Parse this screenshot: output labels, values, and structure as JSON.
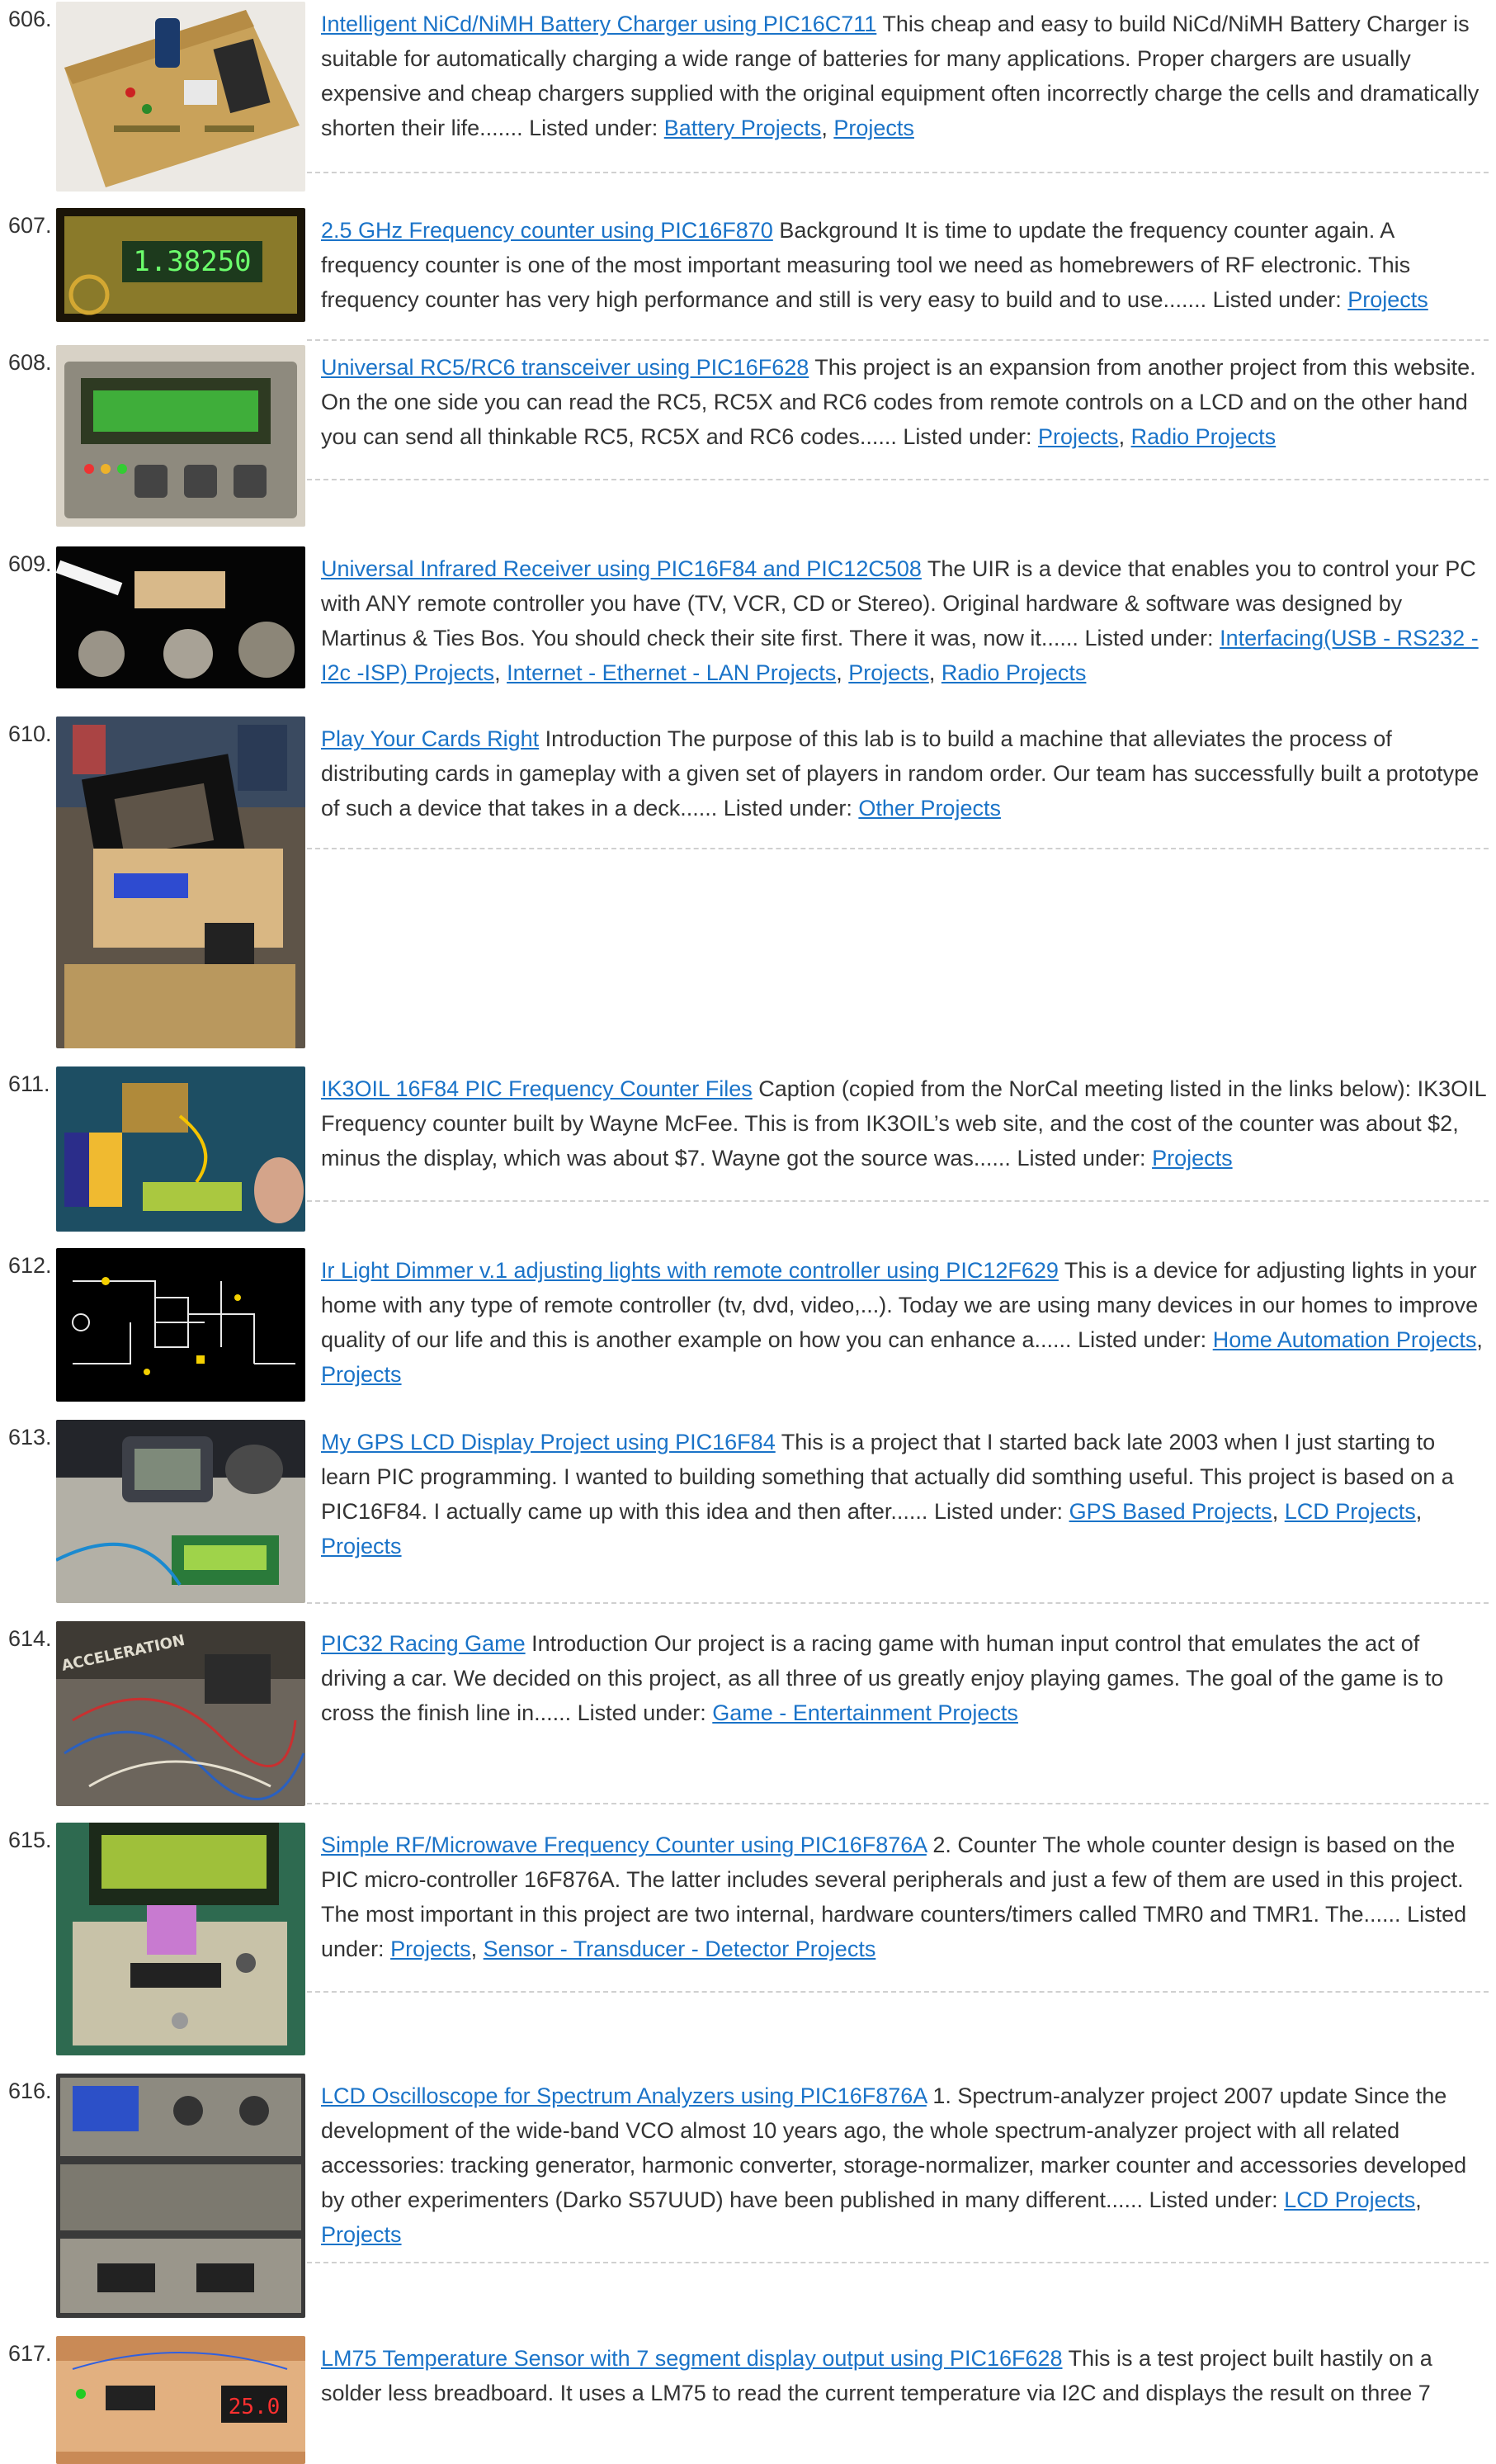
{
  "listed_under_label": "Listed under:",
  "items": [
    {
      "number": "606.",
      "title": "Intelligent NiCd/NiMH Battery Charger using PIC16C711",
      "description": "This cheap and easy to build NiCd/NiMH Battery Charger is suitable for automatically charging a wide range of batteries for many applications. Proper chargers are usually expensive and cheap chargers supplied with the original equipment often incorrectly charge the cells and dramatically shorten their life.......",
      "categories": [
        "Battery Projects",
        "Projects"
      ],
      "thumb": "battery-charger-board"
    },
    {
      "number": "607.",
      "title": "2.5 GHz Frequency counter using PIC16F870",
      "description": "Background It is time to update the frequency counter again. A frequency counter is one of the most important measuring tool we need as homebrewers of RF electronic. This frequency counter has very high performance and still is very easy to build and to use.......",
      "categories": [
        "Projects"
      ],
      "thumb": "frequency-counter-display",
      "thumb_text": "1.38250"
    },
    {
      "number": "608.",
      "title": "Universal RC5/RC6 transceiver using PIC16F628",
      "description": "This project is an expansion from another project from this website. On the one side you can read the RC5, RC5X and RC6 codes from remote controls on a LCD and on the other hand you can send all thinkable RC5, RC5X and RC6 codes......",
      "categories": [
        "Projects",
        "Radio Projects"
      ],
      "thumb": "lcd-transceiver-box"
    },
    {
      "number": "609.",
      "title": "Universal Infrared Receiver using PIC16F84 and PIC12C508",
      "description": "The UIR is a device that enables you to control your PC with ANY remote controller you have (TV, VCR, CD or Stereo). Original hardware & software was designed by Martinus & Ties Bos. You should check their site first. There it was, now it......",
      "categories": [
        "Interfacing(USB - RS232 - I2c -ISP) Projects",
        "Internet - Ethernet - LAN Projects",
        "Projects",
        "Radio Projects"
      ],
      "thumb": "ir-receiver-coins"
    },
    {
      "number": "610.",
      "title": "Play Your Cards Right",
      "description": "Introduction The purpose of this lab is to build a machine that alleviates the process of distributing cards in gameplay with a given set of players in random order. Our team has successfully built a prototype of such a device that takes in a deck......",
      "categories": [
        "Other Projects"
      ],
      "thumb": "card-dealer-machine"
    },
    {
      "number": "611.",
      "title": "IK3OIL 16F84 PIC Frequency Counter Files",
      "description": "Caption (copied from the NorCal meeting listed in the links below): IK3OIL Frequency counter built by Wayne McFee.  This is from IK3OIL’s web site, and the cost of the counter was about $2, minus the display, which was about $7.  Wayne got the source was......",
      "categories": [
        "Projects"
      ],
      "thumb": "counter-with-battery"
    },
    {
      "number": "612.",
      "title": "Ir Light Dimmer v.1 adjusting lights with remote controller using PIC12F629",
      "description": "This is a device for adjusting lights in your home with any type of remote controller (tv, dvd, video,...). Today we are using many devices in our homes to improve quality of our life and this is another example on how you can enhance a......",
      "categories": [
        "Home Automation Projects",
        "Projects"
      ],
      "thumb": "dimmer-schematic"
    },
    {
      "number": "613.",
      "title": "My GPS LCD Display Project using PIC16F84",
      "description": "This is a project that I started back late 2003 when I just starting to learn PIC programming. I wanted to building something that actually did somthing useful. This project is based on a PIC16F84. I actually came up with this idea and then after......",
      "categories": [
        "GPS Based Projects",
        "LCD Projects",
        "Projects"
      ],
      "thumb": "gps-lcd-bench"
    },
    {
      "number": "614.",
      "title": "PIC32 Racing Game",
      "description": "Introduction Our project is a racing game with human input control that emulates the act of driving a car. We decided on this project, as all three of us greatly enjoy playing games. The goal of the game is to cross the finish line in......",
      "categories": [
        "Game - Entertainment Projects"
      ],
      "thumb": "racing-game-wires",
      "thumb_text": "ACCELERATION"
    },
    {
      "number": "615.",
      "title": "Simple RF/Microwave Frequency Counter using PIC16F876A",
      "description": "2. Counter The whole counter design is based on the PIC micro-controller 16F876A. The latter includes several peripherals and just a few of them are used in this project. The most important in this project are two internal, hardware counters/timers called TMR0 and TMR1. The......",
      "categories": [
        "Projects",
        "Sensor - Transducer - Detector Projects"
      ],
      "thumb": "rf-counter-lcd"
    },
    {
      "number": "616.",
      "title": "LCD Oscilloscope for Spectrum Analyzers using PIC16F876A",
      "description": "1. Spectrum-analyzer project 2007 update Since the development of the wide-band VCO almost 10 years ago, the whole spectrum-analyzer project with all related accessories: tracking generator, harmonic converter, storage-normalizer, marker counter and accessories developed by other experimenters (Darko S57UUD) have been published in many different......",
      "categories": [
        "LCD Projects",
        "Projects"
      ],
      "thumb": "spectrum-analyzer-rack"
    },
    {
      "number": "617.",
      "title": "LM75 Temperature Sensor with 7 segment display output using PIC16F628",
      "description": "This is a test project built hastily on a solder less breadboard. It uses a LM75 to read the current temperature via I2C and displays the result on three 7",
      "categories": [],
      "thumb": "breadboard-7segment",
      "thumb_text": "25.0"
    }
  ]
}
